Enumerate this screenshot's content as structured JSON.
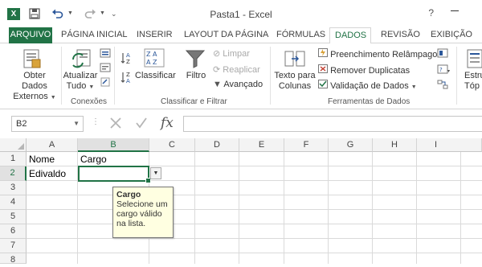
{
  "window": {
    "title": "Pasta1 - Excel",
    "help": "?"
  },
  "tabs": [
    {
      "label": "ARQUIVO"
    },
    {
      "label": "PÁGINA INICIAL"
    },
    {
      "label": "INSERIR"
    },
    {
      "label": "LAYOUT DA PÁGINA"
    },
    {
      "label": "FÓRMULAS"
    },
    {
      "label": "DADOS"
    },
    {
      "label": "REVISÃO"
    },
    {
      "label": "EXIBIÇÃO"
    }
  ],
  "ribbon": {
    "obter_dados": {
      "line1": "Obter Dados",
      "line2": "Externos"
    },
    "atualizar": {
      "line1": "Atualizar",
      "line2": "Tudo"
    },
    "classificar": "Classificar",
    "filtro": "Filtro",
    "limpar": "Limpar",
    "reaplicar": "Reaplicar",
    "avancado": "Avançado",
    "texto_colunas": {
      "line1": "Texto para",
      "line2": "Colunas"
    },
    "preenchimento": "Preenchimento Relâmpago",
    "remover_dup": "Remover Duplicatas",
    "validacao": "Validação de Dados",
    "estrutura": {
      "line1": "Estru",
      "line2": "Tóp"
    },
    "groups": {
      "conexoes": "Conexões",
      "classificar_filtrar": "Classificar e Filtrar",
      "ferramentas": "Ferramentas de Dados"
    }
  },
  "formula_bar": {
    "name_box": "B2",
    "formula": ""
  },
  "grid": {
    "columns": [
      "A",
      "B",
      "C",
      "D",
      "E",
      "F",
      "G",
      "H",
      "I"
    ],
    "selected_column": "B",
    "rows": [
      "1",
      "2",
      "3",
      "4",
      "5",
      "6",
      "7",
      "8"
    ],
    "selected_row": "2",
    "cells": {
      "A1": "Nome",
      "B1": "Cargo",
      "A2": "Edivaldo"
    }
  },
  "tooltip": {
    "title": "Cargo",
    "line1": "Selecione um",
    "line2": "cargo válido",
    "line3": "na lista."
  },
  "colors": {
    "accent": "#217346",
    "tooltip_bg": "#ffffe1"
  }
}
